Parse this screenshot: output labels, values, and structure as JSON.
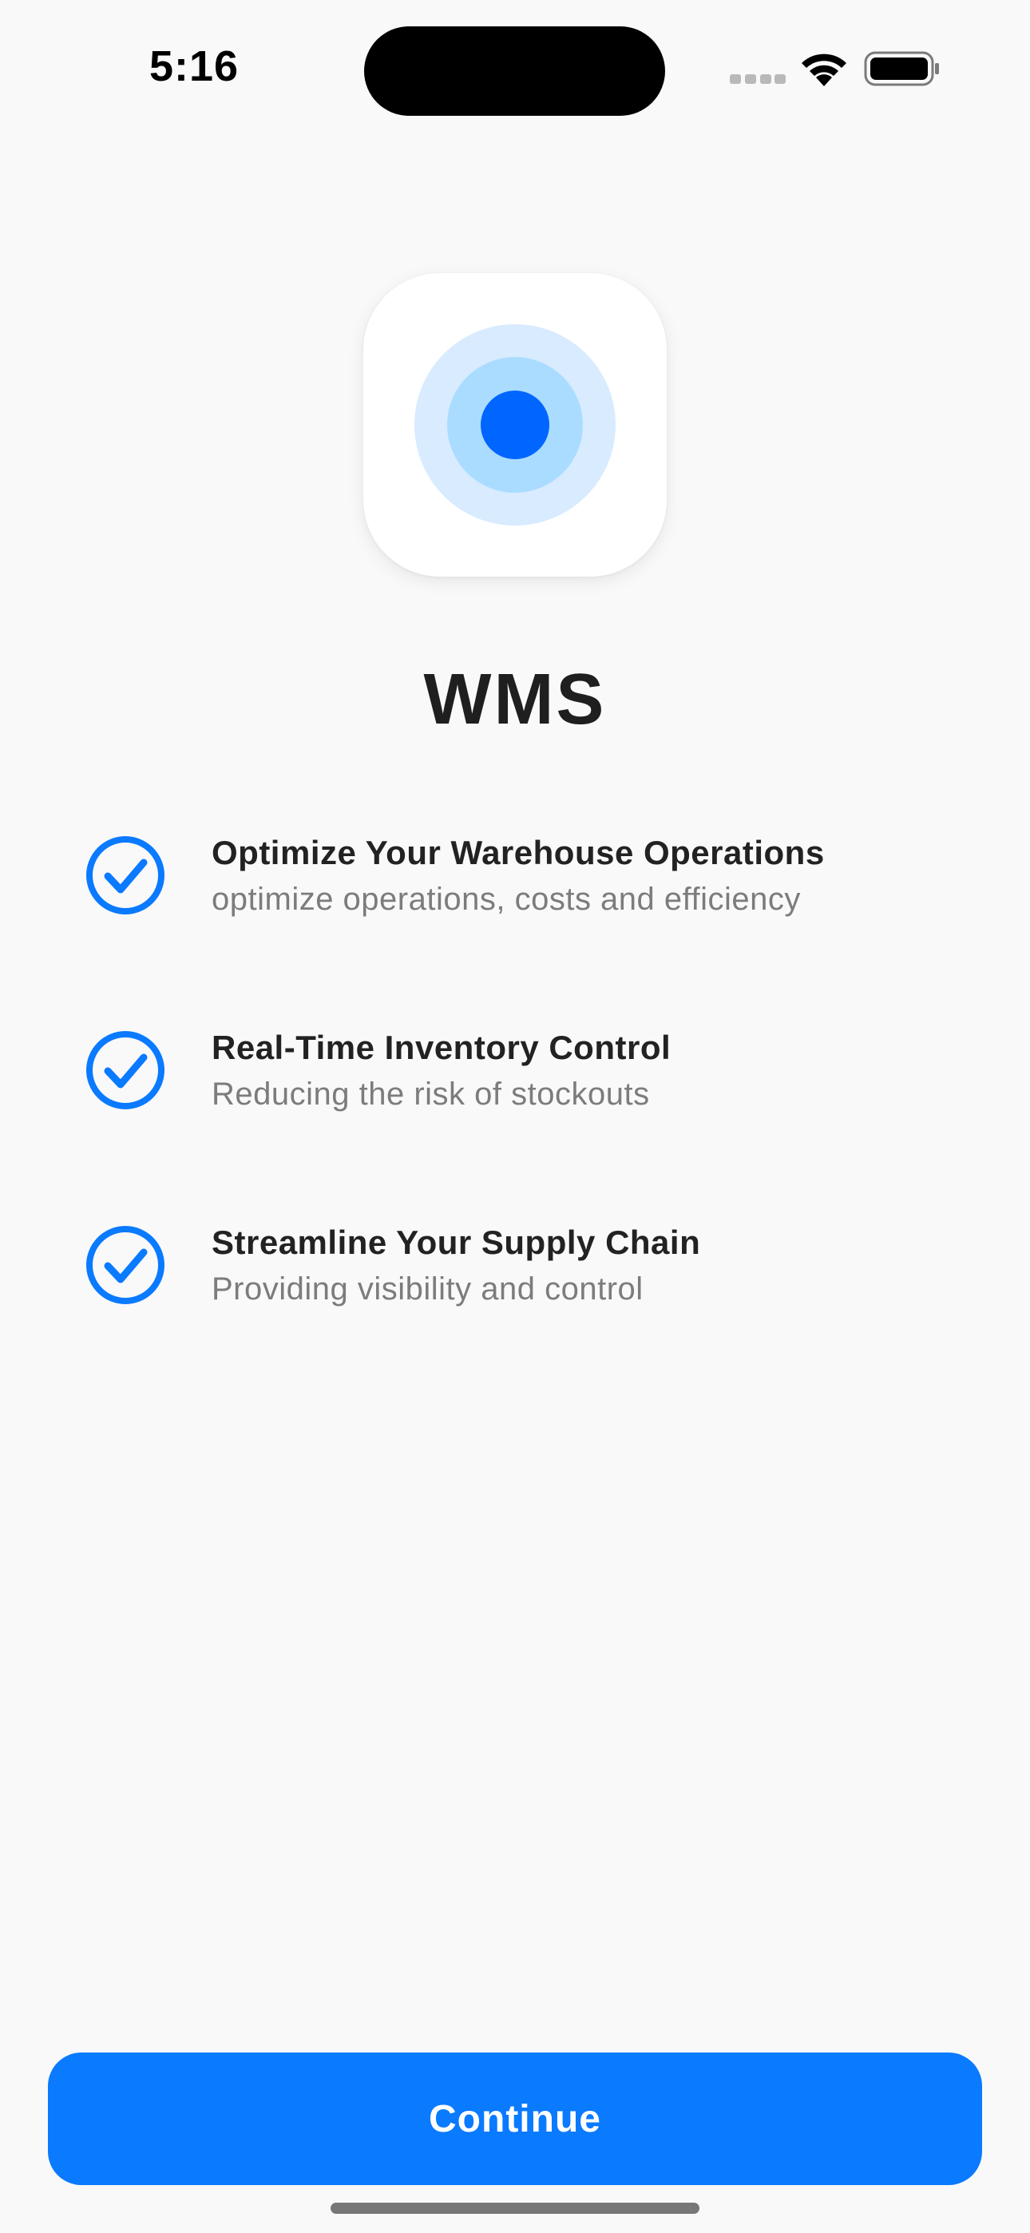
{
  "status_bar": {
    "time": "5:16"
  },
  "app": {
    "title": "WMS",
    "icon": "target-rings-icon"
  },
  "features": [
    {
      "title": "Optimize Your Warehouse Operations",
      "subtitle": "optimize operations, costs and efficiency",
      "icon": "checkmark-circle-icon"
    },
    {
      "title": "Real-Time Inventory Control",
      "subtitle": "Reducing the risk of stockouts",
      "icon": "checkmark-circle-icon"
    },
    {
      "title": "Streamline Your Supply Chain",
      "subtitle": "Providing visibility and control",
      "icon": "checkmark-circle-icon"
    }
  ],
  "continue_button": {
    "label": "Continue"
  },
  "colors": {
    "accent": "#0a7aff",
    "background": "#f9f9f9",
    "ring_outer": "#d8ebff",
    "ring_middle": "#aadcff",
    "ring_center": "#0066ff"
  }
}
